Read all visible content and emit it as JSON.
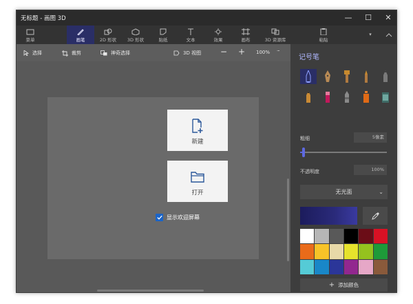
{
  "window": {
    "title": "无标题 - 画图 3D",
    "controls": [
      "—",
      "☐",
      "✕"
    ]
  },
  "ribbon": {
    "tabs": [
      {
        "label": "菜单",
        "icon": "folder-icon"
      },
      {
        "label": "画笔",
        "icon": "brush-icon",
        "active": true
      },
      {
        "label": "2D 形状",
        "icon": "2d-shape-icon"
      },
      {
        "label": "3D 形状",
        "icon": "3d-shape-icon"
      },
      {
        "label": "贴纸",
        "icon": "sticker-icon"
      },
      {
        "label": "文本",
        "icon": "text-icon"
      },
      {
        "label": "效果",
        "icon": "effects-icon"
      },
      {
        "label": "画布",
        "icon": "canvas-icon"
      },
      {
        "label": "3D 资源库",
        "icon": "3d-library-icon"
      }
    ],
    "paste_label": "粘贴"
  },
  "toolbar": {
    "select": "选择",
    "crop": "裁剪",
    "magic_select": "神奇选择",
    "view_3d": "3D 视图",
    "zoom": "100%",
    "more": "···"
  },
  "welcome": {
    "new_label": "新建",
    "open_label": "打开",
    "show_welcome": "显示欢迎屏幕"
  },
  "panel": {
    "title": "记号笔",
    "thickness_label": "粗细",
    "thickness_value": "5像素",
    "thickness_fraction": 0.04,
    "opacity_label": "不透明度",
    "opacity_value": "100%",
    "finish_label": "无光面",
    "add_color_label": "添加颜色",
    "current_color": "#2a2a7a",
    "swatches": [
      "#ffffff",
      "#b6b6b6",
      "#595959",
      "#000000",
      "#6b0d17",
      "#d91124",
      "#e96b1a",
      "#f7c328",
      "#e8d9a8",
      "#e6e22c",
      "#95c21e",
      "#1e9a39",
      "#55cbd6",
      "#1987c8",
      "#2b3699",
      "#92278f",
      "#e6a7c7",
      "#8a5a3b"
    ]
  },
  "colors": {
    "accent": "#5e69e0",
    "checkbox": "#1a64c8"
  }
}
